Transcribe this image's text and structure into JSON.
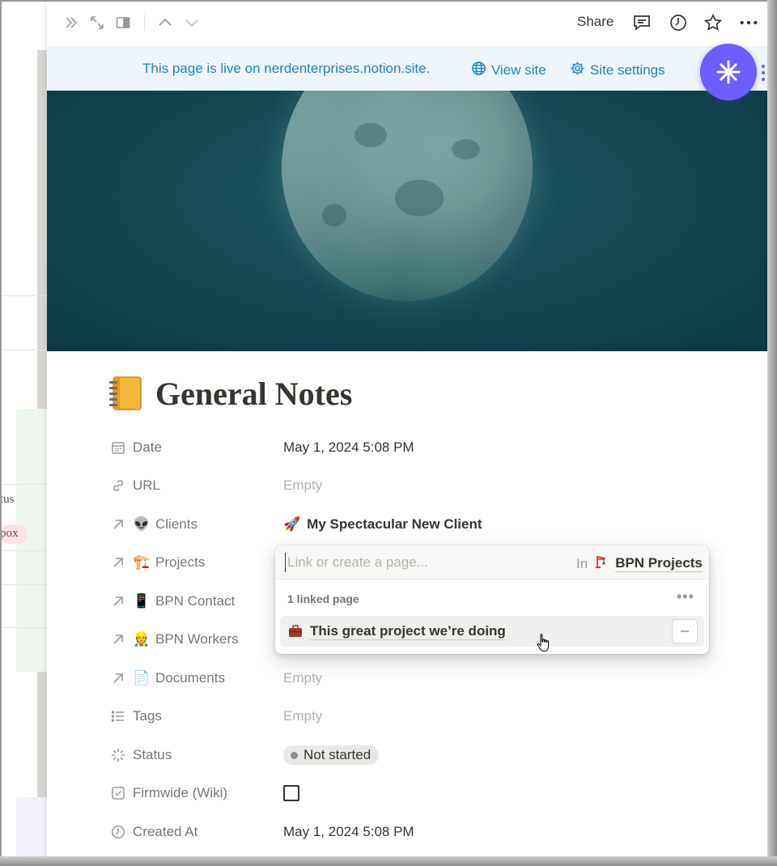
{
  "background": {
    "text_status": "tus",
    "text_inbox": "pox"
  },
  "topbar": {
    "share_label": "Share"
  },
  "banner": {
    "message": "This page is live on nerdenterprises.notion.site.",
    "view_site_label": "View site",
    "site_settings_label": "Site settings"
  },
  "page": {
    "title": "General Notes"
  },
  "properties": {
    "date": {
      "label": "Date",
      "value": "May 1, 2024 5:08 PM"
    },
    "url": {
      "label": "URL",
      "value": "Empty"
    },
    "clients": {
      "label": "Clients",
      "emoji": "👽",
      "value": "My Spectacular New Client",
      "value_emoji": "🚀"
    },
    "projects": {
      "label": "Projects",
      "emoji": "🏗️"
    },
    "bpn_contact": {
      "label": "BPN Contact",
      "emoji": "📱"
    },
    "bpn_workers": {
      "label": "BPN Workers",
      "emoji": "👷"
    },
    "documents": {
      "label": "Documents",
      "emoji": "📄",
      "value": "Empty"
    },
    "tags": {
      "label": "Tags",
      "value": "Empty"
    },
    "status": {
      "label": "Status",
      "value": "Not started"
    },
    "firmwide": {
      "label": "Firmwide (Wiki)",
      "checked": false
    },
    "created_at": {
      "label": "Created At",
      "value": "May 1, 2024 5:08 PM"
    }
  },
  "relation_popup": {
    "placeholder": "Link or create a page...",
    "in_label": "In",
    "database_name": "BPN Projects",
    "linked_count_label": "1 linked page",
    "more_label": "•••",
    "linked_pages": [
      {
        "title": "This great project we’re doing"
      }
    ]
  },
  "colors": {
    "accent_blue": "#2383c4",
    "banner_bg": "#eef5fb",
    "ai_button": "#6d5dfc",
    "text": "#37352f",
    "muted": "#787774"
  }
}
